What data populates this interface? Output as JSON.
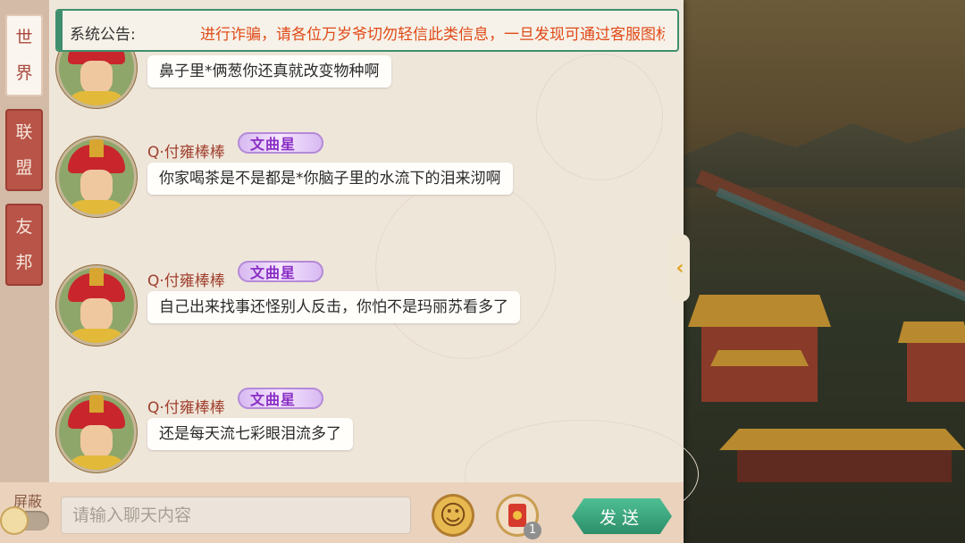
{
  "announcement": {
    "label": "系统公告:",
    "text": "进行诈骗，请各位万岁爷切勿轻信此类信息，一旦发现可通过客服图标"
  },
  "tabs": [
    {
      "chars": [
        "世",
        "界"
      ],
      "active": true
    },
    {
      "chars": [
        "联",
        "盟"
      ],
      "active": false
    },
    {
      "chars": [
        "友",
        "邦"
      ],
      "active": false
    }
  ],
  "messages": [
    {
      "user": "",
      "badge": "",
      "text": "鼻子里*俩葱你还真就改变物种啊"
    },
    {
      "user": "Q·付雍棒棒",
      "badge": "文曲星",
      "text": "你家喝茶是不是都是*你脑子里的水流下的泪来沏啊"
    },
    {
      "user": "Q·付雍棒棒",
      "badge": "文曲星",
      "text": "自己出来找事还怪别人反击，你怕不是玛丽苏看多了"
    },
    {
      "user": "Q·付雍棒棒",
      "badge": "文曲星",
      "text": "还是每天流七彩眼泪流多了"
    }
  ],
  "bottom": {
    "mute_label": "屏蔽",
    "input_placeholder": "请输入聊天内容",
    "redpacket_count": "1",
    "send_label": "发送"
  },
  "icons": {
    "collapse": "chevron-left-icon",
    "emoji": "emoji-face-icon",
    "redpacket": "red-envelope-icon"
  },
  "colors": {
    "accent_green": "#3f8f6e",
    "tab_red": "#b85448",
    "username": "#a0402e",
    "announce_text": "#e04a18"
  }
}
